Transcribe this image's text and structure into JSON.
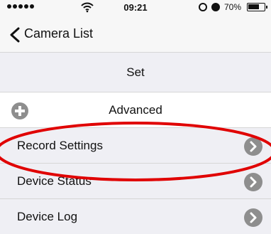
{
  "status_bar": {
    "time": "09:21",
    "battery": "70%",
    "battery_level": 0.7,
    "signal_icon": "signal-dots-icon",
    "wifi_icon": "wifi-icon",
    "lock_icon": "rotation-lock-icon",
    "alarm_icon": "alarm-icon"
  },
  "navbar": {
    "back_label": "Camera List",
    "back_icon": "chevron-left-icon"
  },
  "section": {
    "title": "Set"
  },
  "advanced": {
    "label": "Advanced",
    "icon": "plus-circle-icon"
  },
  "menu": {
    "items": [
      {
        "label": "Record Settings",
        "icon": "chevron-right-circle-icon"
      },
      {
        "label": "Device Status",
        "icon": "chevron-right-circle-icon"
      },
      {
        "label": "Device Log",
        "icon": "chevron-right-circle-icon"
      }
    ]
  },
  "colors": {
    "highlight": "#e00000",
    "icon_gray": "#8e8e8e",
    "row_bg": "#efeff4",
    "bar_bg": "#f7f7f7"
  }
}
